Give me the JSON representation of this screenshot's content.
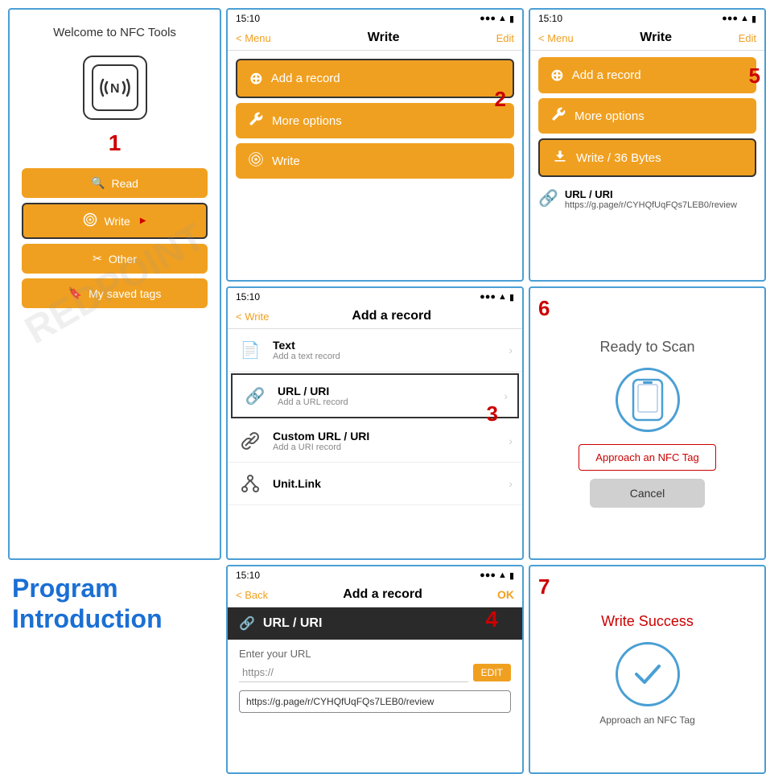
{
  "page": {
    "title": "NFC Tools Program Introduction"
  },
  "panel1": {
    "welcome_text": "Welcome to NFC Tools",
    "step_number": "1",
    "menu_items": [
      {
        "label": "Read",
        "icon": "search"
      },
      {
        "label": "Write",
        "icon": "write",
        "selected": true
      },
      {
        "label": "Other",
        "icon": "tools"
      },
      {
        "label": "My saved tags",
        "icon": "bookmark"
      }
    ]
  },
  "panel2": {
    "time": "15:10",
    "back_label": "< Menu",
    "title": "Write",
    "edit_label": "Edit",
    "buttons": [
      {
        "label": "Add a record",
        "outlined": true
      },
      {
        "label": "More options"
      },
      {
        "label": "Write"
      }
    ],
    "step_number": "2"
  },
  "panel3": {
    "time": "15:10",
    "back_label": "< Write",
    "title": "Add a record",
    "records": [
      {
        "title": "Text",
        "subtitle": "Add a text record"
      },
      {
        "title": "URL / URI",
        "subtitle": "Add a URL record",
        "outlined": true
      },
      {
        "title": "Custom URL / URI",
        "subtitle": "Add a URI record"
      },
      {
        "title": "Unit.Link",
        "subtitle": ""
      }
    ],
    "step_number": "3"
  },
  "panel4": {
    "time": "15:10",
    "back_label": "< Back",
    "title": "Add a record",
    "ok_label": "OK",
    "url_header": "URL / URI",
    "enter_url_label": "Enter your URL",
    "placeholder": "https://",
    "edit_btn": "EDIT",
    "url_value": "https://g.page/r/CYHQfUqFQs7LEB0/review",
    "step_number": "4"
  },
  "panel5": {
    "time": "15:10",
    "back_label": "< Menu",
    "title": "Write",
    "edit_label": "Edit",
    "buttons": [
      {
        "label": "Add a record"
      },
      {
        "label": "More options"
      },
      {
        "label": "Write / 36 Bytes",
        "outlined": true
      }
    ],
    "step_number": "5",
    "url_section": {
      "label": "URL / URI",
      "value": "https://g.page/r/CYHQfUqFQs7LEB0/review"
    }
  },
  "panel6": {
    "title": "Ready to Scan",
    "step_number": "6",
    "approach_btn": "Approach an NFC Tag",
    "cancel_btn": "Cancel"
  },
  "panel7": {
    "title": "Write Success",
    "step_number": "7",
    "approach_text": "Approach an NFC Tag"
  },
  "program_intro": {
    "line1": "Program",
    "line2": "Introduction"
  },
  "icons": {
    "search": "🔍",
    "write": "✎",
    "tools": "✂",
    "bookmark": "🔖",
    "link": "🔗",
    "text_icon": "📄"
  }
}
